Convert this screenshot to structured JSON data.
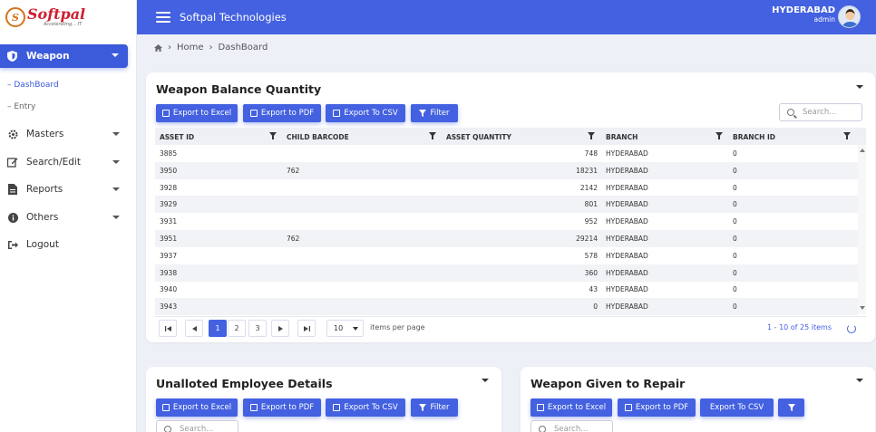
{
  "logo": {
    "name": "Softpal",
    "tagline": "Accelerating... IT"
  },
  "sidebar": {
    "active": {
      "label": "Weapon"
    },
    "sub": [
      "DashBoard",
      "Entry"
    ],
    "items": [
      {
        "label": "Masters",
        "icon": "gear-icon",
        "caret": true
      },
      {
        "label": "Search/Edit",
        "icon": "edit-icon",
        "caret": true
      },
      {
        "label": "Reports",
        "icon": "document-icon",
        "caret": true
      },
      {
        "label": "Others",
        "icon": "info-icon",
        "caret": true
      },
      {
        "label": "Logout",
        "icon": "logout-icon",
        "caret": false
      }
    ]
  },
  "topbar": {
    "company": "Softpal Technologies",
    "city": "HYDERABAD",
    "role": "admin"
  },
  "breadcrumb": {
    "home": "Home",
    "current": "DashBoard"
  },
  "balance": {
    "title": "Weapon Balance Quantity",
    "buttons": {
      "excel": "Export to Excel",
      "pdf": "Export to PDF",
      "csv": "Export To CSV",
      "filter": "Filter"
    },
    "search_placeholder": "Search...",
    "columns": [
      "ASSET ID",
      "CHILD BARCODE",
      "ASSET QUANTITY",
      "BRANCH",
      "BRANCH ID"
    ],
    "rows": [
      [
        "3885",
        "",
        "748",
        "HYDERABAD",
        "0"
      ],
      [
        "3950",
        "762",
        "18231",
        "HYDERABAD",
        "0"
      ],
      [
        "3928",
        "",
        "2142",
        "HYDERABAD",
        "0"
      ],
      [
        "3929",
        "",
        "801",
        "HYDERABAD",
        "0"
      ],
      [
        "3931",
        "",
        "952",
        "HYDERABAD",
        "0"
      ],
      [
        "3951",
        "762",
        "29214",
        "HYDERABAD",
        "0"
      ],
      [
        "3937",
        "",
        "578",
        "HYDERABAD",
        "0"
      ],
      [
        "3938",
        "",
        "360",
        "HYDERABAD",
        "0"
      ],
      [
        "3940",
        "",
        "43",
        "HYDERABAD",
        "0"
      ],
      [
        "3943",
        "",
        "0",
        "HYDERABAD",
        "0"
      ]
    ],
    "pager": {
      "pages": [
        "1",
        "2",
        "3"
      ],
      "page_size": "10",
      "per_page_label": "items per page",
      "info": "1 - 10 of 25 items"
    }
  },
  "unalloted": {
    "title": "Unalloted Employee Details",
    "buttons": {
      "excel": "Export to Excel",
      "pdf": "Export to PDF",
      "csv": "Export To CSV",
      "filter": "Filter"
    },
    "search_placeholder": "Search..."
  },
  "repair": {
    "title": "Weapon Given to Repair",
    "buttons": {
      "excel": "Export to Excel",
      "pdf": "Export to PDF",
      "csv": "Export To CSV"
    },
    "search_placeholder": "Search..."
  },
  "colors": {
    "primary": "#4361e0",
    "active": "#3b5bdb",
    "brand": "#d01f2f"
  }
}
